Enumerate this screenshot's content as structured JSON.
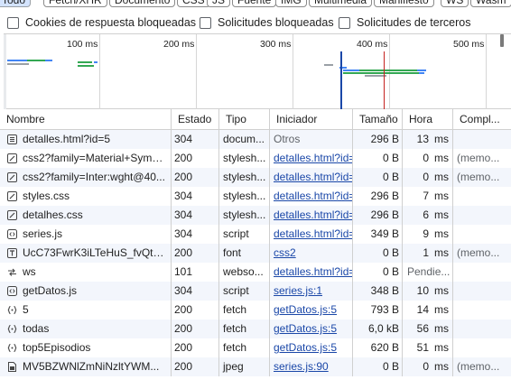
{
  "filters": {
    "chips": [
      {
        "label": "Todo",
        "active": true
      },
      {
        "label": "Fetch/XHR",
        "active": false
      },
      {
        "label": "Documento",
        "active": false
      },
      {
        "label": "CSS",
        "active": false
      },
      {
        "label": "JS",
        "active": false
      },
      {
        "label": "Fuente",
        "active": false
      },
      {
        "label": "IMG",
        "active": false
      },
      {
        "label": "Multimedia",
        "active": false
      },
      {
        "label": "Manifiesto",
        "active": false
      },
      {
        "label": "WS",
        "active": false
      },
      {
        "label": "Wasm",
        "active": false
      }
    ],
    "checkboxes": [
      {
        "label": "Cookies de respuesta bloqueadas",
        "checked": false
      },
      {
        "label": "Solicitudes bloqueadas",
        "checked": false
      },
      {
        "label": "Solicitudes de terceros",
        "checked": false
      }
    ]
  },
  "overview": {
    "ticks": [
      "100 ms",
      "200 ms",
      "300 ms",
      "400 ms",
      "500 ms"
    ],
    "colors": {
      "blue_marker": "#1a47a8",
      "red_marker": "#c5221f",
      "waiting": "#34a853",
      "receiving": "#4285f4"
    }
  },
  "table": {
    "columns": [
      "Nombre",
      "Estado",
      "Tipo",
      "Iniciador",
      "Tamaño",
      "Hora",
      "Compl..."
    ],
    "rows": [
      {
        "name": "detalles.html?id=5",
        "icon": "document-icon",
        "status": "304",
        "type": "docum...",
        "initiator": "Otros",
        "initiator_link": false,
        "size": "296 B",
        "time": "13",
        "time_unit": "ms",
        "completion": ""
      },
      {
        "name": "css2?family=Material+Symb...",
        "icon": "stylesheet-icon",
        "status": "200",
        "type": "stylesh...",
        "initiator": "detalles.html?id=",
        "initiator_link": true,
        "size": "0 B",
        "time": "0",
        "time_unit": "ms",
        "completion": "(memo..."
      },
      {
        "name": "css2?family=Inter:wght@40...",
        "icon": "stylesheet-icon",
        "status": "200",
        "type": "stylesh...",
        "initiator": "detalles.html?id=",
        "initiator_link": true,
        "size": "0 B",
        "time": "0",
        "time_unit": "ms",
        "completion": "(memo..."
      },
      {
        "name": "styles.css",
        "icon": "stylesheet-icon",
        "status": "304",
        "type": "stylesh...",
        "initiator": "detalles.html?id=",
        "initiator_link": true,
        "size": "296 B",
        "time": "7",
        "time_unit": "ms",
        "completion": ""
      },
      {
        "name": "detalhes.css",
        "icon": "stylesheet-icon",
        "status": "304",
        "type": "stylesh...",
        "initiator": "detalles.html?id=",
        "initiator_link": true,
        "size": "296 B",
        "time": "6",
        "time_unit": "ms",
        "completion": ""
      },
      {
        "name": "series.js",
        "icon": "script-icon",
        "status": "304",
        "type": "script",
        "initiator": "detalles.html?id=",
        "initiator_link": true,
        "size": "349 B",
        "time": "9",
        "time_unit": "ms",
        "completion": ""
      },
      {
        "name": "UcC73FwrK3iLTeHuS_fvQtM...",
        "icon": "font-icon",
        "status": "200",
        "type": "font",
        "initiator": "css2",
        "initiator_link": true,
        "size": "0 B",
        "time": "1",
        "time_unit": "ms",
        "completion": "(memo..."
      },
      {
        "name": "ws",
        "icon": "websocket-icon",
        "status": "101",
        "type": "webso...",
        "initiator": "detalles.html?id=",
        "initiator_link": true,
        "size": "0 B",
        "time": "Pendie...",
        "time_unit": "",
        "completion": ""
      },
      {
        "name": "getDatos.js",
        "icon": "script-icon",
        "status": "304",
        "type": "script",
        "initiator": "series.js:1",
        "initiator_link": true,
        "size": "348 B",
        "time": "10",
        "time_unit": "ms",
        "completion": ""
      },
      {
        "name": "5",
        "icon": "fetch-icon",
        "status": "200",
        "type": "fetch",
        "initiator": "getDatos.js:5",
        "initiator_link": true,
        "size": "793 B",
        "time": "14",
        "time_unit": "ms",
        "completion": ""
      },
      {
        "name": "todas",
        "icon": "fetch-icon",
        "status": "200",
        "type": "fetch",
        "initiator": "getDatos.js:5",
        "initiator_link": true,
        "size": "6,0 kB",
        "time": "56",
        "time_unit": "ms",
        "completion": ""
      },
      {
        "name": "top5Episodios",
        "icon": "fetch-icon",
        "status": "200",
        "type": "fetch",
        "initiator": "getDatos.js:5",
        "initiator_link": true,
        "size": "620 B",
        "time": "51",
        "time_unit": "ms",
        "completion": ""
      },
      {
        "name": "MV5BZWNlZmNiNzltYWM...",
        "icon": "image-icon",
        "status": "200",
        "type": "jpeg",
        "initiator": "series.js:90",
        "initiator_link": true,
        "size": "0 B",
        "time": "0",
        "time_unit": "ms",
        "completion": "(memo..."
      }
    ]
  }
}
